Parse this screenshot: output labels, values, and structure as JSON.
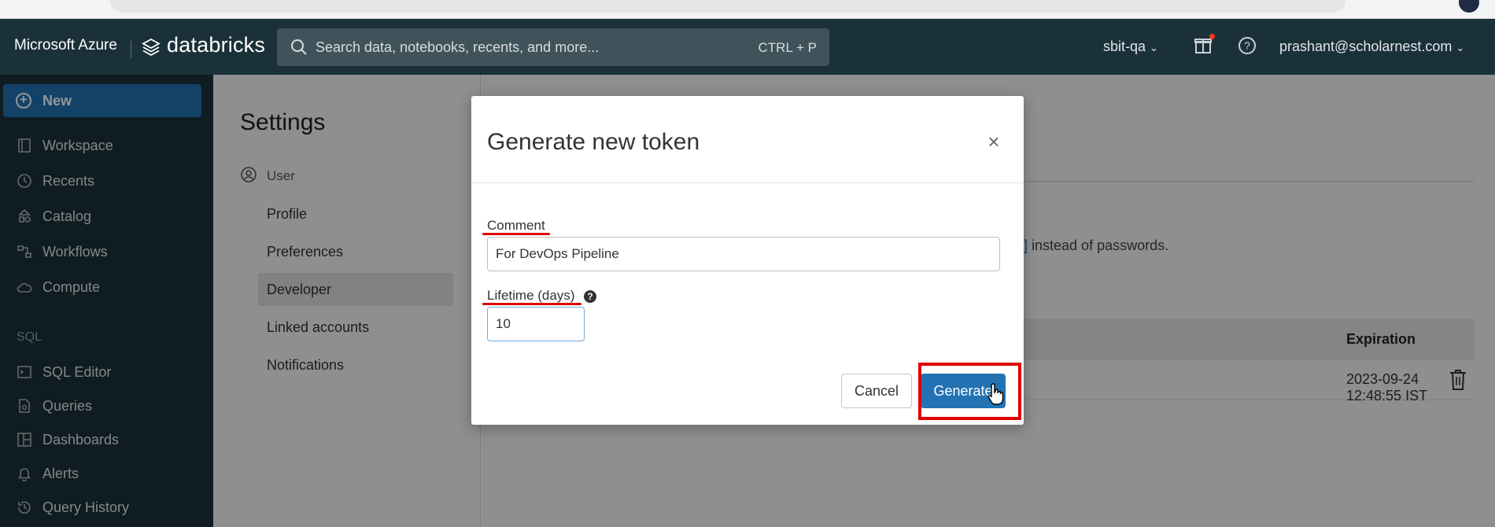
{
  "header": {
    "brand_azure": "Microsoft Azure",
    "brand_name": "databricks",
    "search_placeholder": "Search data, notebooks, recents, and more...",
    "search_shortcut": "CTRL + P",
    "workspace": "sbit-qa",
    "user_email": "prashant@scholarnest.com"
  },
  "sidebar": {
    "new_label": "New",
    "items": [
      {
        "label": "Workspace",
        "icon": "workspace-icon"
      },
      {
        "label": "Recents",
        "icon": "clock-icon"
      },
      {
        "label": "Catalog",
        "icon": "catalog-icon"
      },
      {
        "label": "Workflows",
        "icon": "workflows-icon"
      },
      {
        "label": "Compute",
        "icon": "cloud-icon"
      }
    ],
    "sql_section": "SQL",
    "sql_items": [
      {
        "label": "SQL Editor",
        "icon": "sql-editor-icon"
      },
      {
        "label": "Queries",
        "icon": "queries-icon"
      },
      {
        "label": "Dashboards",
        "icon": "dashboards-icon"
      },
      {
        "label": "Alerts",
        "icon": "bell-icon"
      },
      {
        "label": "Query History",
        "icon": "history-icon"
      }
    ]
  },
  "settings": {
    "title": "Settings",
    "section": "User",
    "items": [
      {
        "label": "Profile"
      },
      {
        "label": "Preferences"
      },
      {
        "label": "Developer"
      },
      {
        "label": "Linked accounts"
      },
      {
        "label": "Notifications"
      }
    ],
    "active_item": "Developer",
    "bg_text_link": "?]",
    "bg_text": " instead of passwords.",
    "table": {
      "header": "Expiration",
      "row_expiration": "2023-09-24 12:48:55 IST"
    }
  },
  "modal": {
    "title": "Generate new token",
    "close_symbol": "×",
    "comment_label": "Comment",
    "comment_value": "For DevOps Pipeline",
    "lifetime_label": "Lifetime (days)",
    "lifetime_value": "10",
    "cancel_label": "Cancel",
    "generate_label": "Generate"
  },
  "colors": {
    "topbar": "#1b3139",
    "accent": "#2272b4",
    "annotation_red": "#e00000"
  }
}
